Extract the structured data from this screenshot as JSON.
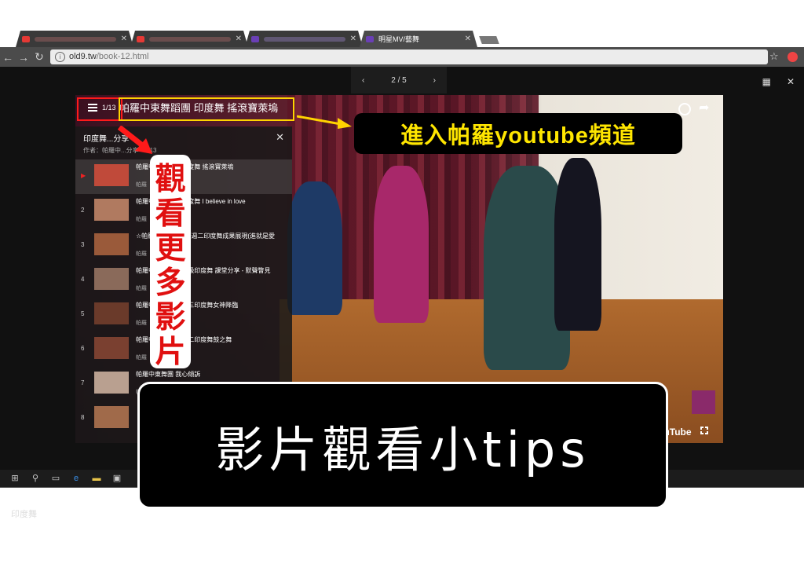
{
  "browser": {
    "tabs": [
      {
        "label": "",
        "favicon_color": "#e53935"
      },
      {
        "label": "",
        "favicon_color": "#e53935"
      },
      {
        "label": "",
        "favicon_color": "#6a3fb5"
      },
      {
        "label": "明星MV/藝舞",
        "favicon_color": "#6a3fb5"
      }
    ],
    "tab_close": "✕",
    "url_host": "old9.tw",
    "url_path": "/book-12.html"
  },
  "lightbox": {
    "prev": "‹",
    "page_indicator": "2 / 5",
    "next": "›",
    "grid_icon": "▦",
    "close": "✕"
  },
  "video": {
    "title": "帕羅中東舞蹈團 印度舞 搖滾寶萊塢",
    "playlist_position": "1/13",
    "brand": "YouTube",
    "playlist": {
      "title": "印度舞...分享",
      "author": "作者：帕羅中...分享 • 1/13",
      "items": [
        {
          "num": "▶",
          "title": "帕羅中東舞蹈團 印度舞 搖滾寶萊塢",
          "by": "帕羅",
          "thumb": "#c04a3a"
        },
        {
          "num": "2",
          "title": "帕羅中東舞蹈團 印度舞 I believe in love",
          "by": "帕羅",
          "thumb": "#b07a60"
        },
        {
          "num": "3",
          "title": "☆帕羅中東舞蹈團☆週二印度舞成果展現(進就是愛",
          "by": "帕羅",
          "thumb": "#9a5a3a"
        },
        {
          "num": "4",
          "title": "帕羅中東舞蹈團 中級印度舞 課堂分享 - 默聲瞥見",
          "by": "帕羅",
          "thumb": "#8a6a5a"
        },
        {
          "num": "5",
          "title": "帕羅中東舞蹈團 週三印度舞女神降臨",
          "by": "帕羅",
          "thumb": "#6a3a2a"
        },
        {
          "num": "6",
          "title": "帕羅中東舞蹈團 週二印度舞鼓之舞",
          "by": "帕羅",
          "thumb": "#7a4030"
        },
        {
          "num": "7",
          "title": "帕羅中東舞團 我心傾訴",
          "by": "帕羅",
          "thumb": "#b9a090"
        },
        {
          "num": "8",
          "title": "",
          "by": "",
          "thumb": "#a06a4a"
        }
      ]
    }
  },
  "annotations": {
    "youtube_channel": "進入帕羅youtube頻道",
    "watch_more": [
      "觀",
      "看",
      "更",
      "多",
      "影",
      "片"
    ],
    "banner": "影片觀看小tips"
  },
  "footer": {
    "caption": "印度舞"
  },
  "colors": {
    "red": "#ff1a1a",
    "yellow": "#ffd400",
    "page_bg": "#111111"
  }
}
